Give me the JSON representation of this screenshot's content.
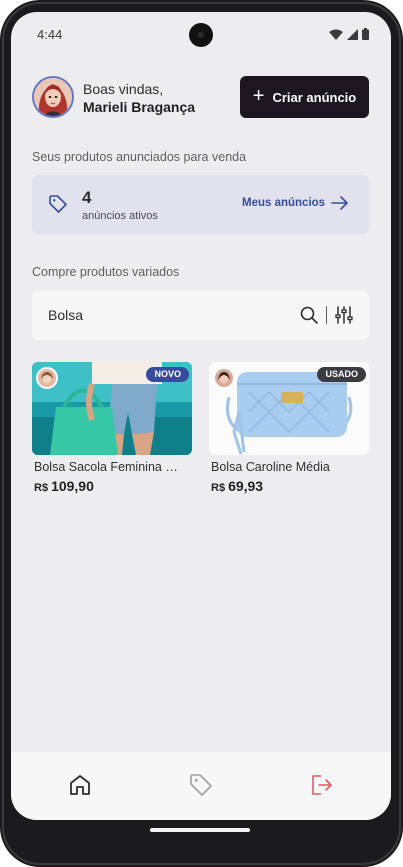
{
  "status_bar": {
    "time": "4:44"
  },
  "header": {
    "greeting": "Boas vindas,",
    "user_name": "Marieli Bragança",
    "create_button_label": "Criar anúncio"
  },
  "my_ads": {
    "section_label": "Seus produtos anunciados para venda",
    "active_count": "4",
    "active_caption": "anúncios ativos",
    "link_label": "Meus anúncios"
  },
  "browse": {
    "section_label": "Compre produtos variados",
    "search_value": "Bolsa"
  },
  "products": [
    {
      "name": "Bolsa Sacola Feminina Gucci",
      "currency": "R$",
      "price": "109,90",
      "badge": "NOVO"
    },
    {
      "name": "Bolsa Caroline Média",
      "currency": "R$",
      "price": "69,93",
      "badge": "USADO"
    }
  ],
  "tab_bar": {
    "icons": [
      "home-icon",
      "tag-icon",
      "sign-out-icon"
    ],
    "active_tab": "home"
  },
  "colors": {
    "primary_dark": "#1b1620",
    "accent_blue": "#364d9d",
    "sign_out_red": "#e05a5a",
    "screen_bg": "#ededf0"
  }
}
